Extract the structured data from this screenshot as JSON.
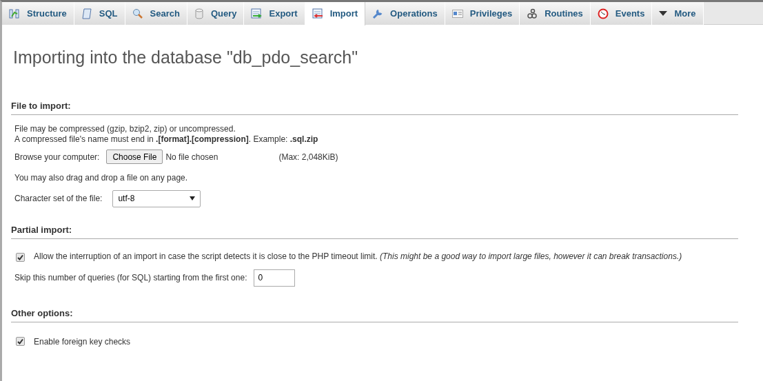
{
  "tabs": [
    {
      "label": "Structure",
      "selected": false
    },
    {
      "label": "SQL",
      "selected": false
    },
    {
      "label": "Search",
      "selected": false
    },
    {
      "label": "Query",
      "selected": false
    },
    {
      "label": "Export",
      "selected": false
    },
    {
      "label": "Import",
      "selected": true
    },
    {
      "label": "Operations",
      "selected": false
    },
    {
      "label": "Privileges",
      "selected": false
    },
    {
      "label": "Routines",
      "selected": false
    },
    {
      "label": "Events",
      "selected": false
    },
    {
      "label": "More",
      "selected": false
    }
  ],
  "page_title": "Importing into the database \"db_pdo_search\"",
  "file_section": {
    "legend": "File to import:",
    "note": "File may be compressed (gzip, bzip2, zip) or uncompressed.",
    "note2": "A compressed file's name must end in **.[format].[compression]**. Example: **.sql.zip**",
    "browse_label": "Browse your computer:",
    "choose_button": "Choose File",
    "file_status": "No file chosen",
    "max_size": "(Max: 2,048KiB)",
    "drag_note": "You may also drag and drop a file on any page.",
    "charset_label": "Character set of the file:",
    "charset_value": "utf-8"
  },
  "partial_section": {
    "legend": "Partial import:",
    "allow_interrupt": {
      "label": "Allow the interruption of an import in case the script detects it is close to the PHP timeout limit. *(This might be a good way to import large files, however it can break transactions.)*",
      "checked": true
    },
    "skip_label": "Skip this number of queries (for SQL) starting from the first one:",
    "skip_value": "0"
  },
  "other_section": {
    "legend": "Other options:",
    "foreign_keys": {
      "label": "Enable foreign key checks",
      "checked": true
    }
  }
}
